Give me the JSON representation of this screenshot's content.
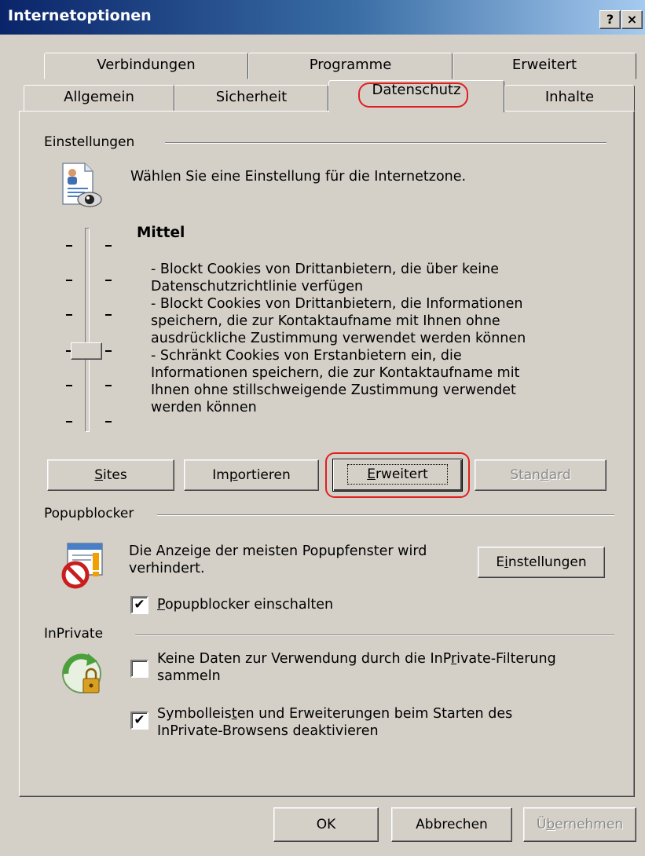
{
  "window": {
    "title": "Internetoptionen",
    "help_button": "?",
    "close_button": "×"
  },
  "tabs": {
    "row1": [
      "Verbindungen",
      "Programme",
      "Erweitert"
    ],
    "row2": [
      "Allgemein",
      "Sicherheit",
      "Datenschutz",
      "Inhalte"
    ],
    "active": "Datenschutz"
  },
  "settings": {
    "group_label": "Einstellungen",
    "intro": "Wählen Sie eine Einstellung für die Internetzone.",
    "level_title": "Mittel",
    "slider_level_index": 3,
    "slider_levels_total": 6,
    "description_lines": [
      "- Blockt Cookies von Drittanbietern, die über keine",
      "Datenschutzrichtlinie verfügen",
      "- Blockt Cookies von Drittanbietern, die Informationen",
      "speichern, die zur Kontaktaufname mit Ihnen ohne",
      "ausdrückliche Zustimmung verwendet werden können",
      "- Schränkt Cookies von Erstanbietern ein, die",
      "Informationen speichern, die zur Kontaktaufname mit",
      "Ihnen ohne stillschweigende Zustimmung verwendet",
      "werden können"
    ],
    "buttons": {
      "sites_u": "S",
      "sites_rest": "ites",
      "import_a": "Im",
      "import_u": "p",
      "import_b": "ortieren",
      "advanced_u": "E",
      "advanced_rest": "rweitert",
      "default_a": "Stan",
      "default_u": "d",
      "default_b": "ard"
    }
  },
  "popup": {
    "group_label": "Popupblocker",
    "text_line1": "Die Anzeige der meisten Popupfenster wird",
    "text_line2": "verhindert.",
    "settings_a": "E",
    "settings_u": "i",
    "settings_b": "nstellungen",
    "checkbox_u": "P",
    "checkbox_rest": "opupblocker einschalten",
    "checkbox_checked": true
  },
  "inprivate": {
    "group_label": "InPrivate",
    "cb1_line1_a": "Keine Daten zur Verwendung durch die InP",
    "cb1_line1_u": "r",
    "cb1_line1_b": "ivate-Filterung",
    "cb1_line2": "sammeln",
    "cb1_checked": false,
    "cb2_line1_a": "Symbolleis",
    "cb2_line1_u": "t",
    "cb2_line1_b": "en und Erweiterungen beim Starten des",
    "cb2_line2": "InPrivate-Browsens deaktivieren",
    "cb2_checked": true
  },
  "footer": {
    "ok": "OK",
    "cancel": "Abbrechen",
    "apply_a": "Ü",
    "apply_u": "b",
    "apply_b": "ernehmen"
  },
  "colors": {
    "titlebar_start": "#0a246a",
    "titlebar_end": "#a6caf0",
    "face": "#d4d0c8",
    "highlight_circle": "#e02020"
  }
}
